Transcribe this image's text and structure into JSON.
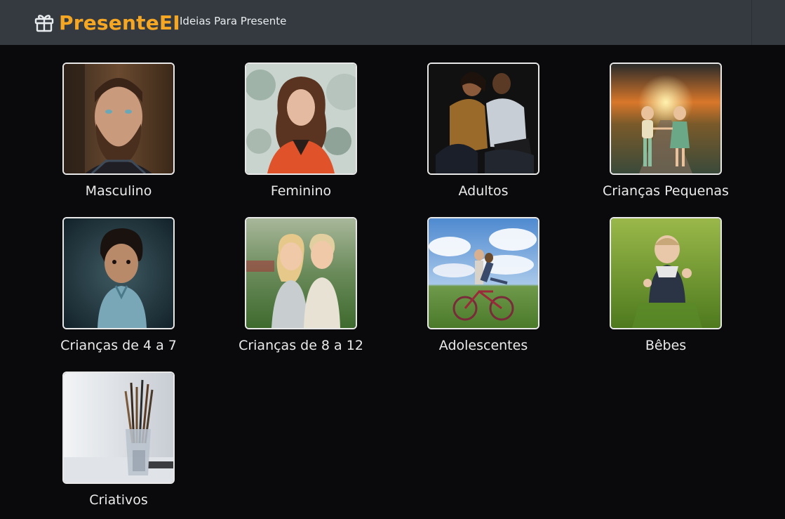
{
  "navbar": {
    "brand": "PresenteEI",
    "brand_icon": "gift-icon",
    "brand_color": "#f5a623",
    "links": [
      {
        "label": "Ideias Para Presente"
      }
    ]
  },
  "categories": [
    {
      "label": "Masculino",
      "image": "bearded-man-photo"
    },
    {
      "label": "Feminino",
      "image": "woman-in-snow-photo"
    },
    {
      "label": "Adultos",
      "image": "couple-with-laptop-photo"
    },
    {
      "label": "Crianças Pequenas",
      "image": "children-at-sunset-photo"
    },
    {
      "label": "Crianças de 4 a 7",
      "image": "curly-haired-boy-photo"
    },
    {
      "label": "Crianças de 8 a 12",
      "image": "two-kids-smiling-photo"
    },
    {
      "label": "Adolescentes",
      "image": "couple-on-bicycle-photo"
    },
    {
      "label": "Bêbes",
      "image": "baby-in-grass-photo"
    },
    {
      "label": "Criativos",
      "image": "paint-brushes-photo"
    }
  ]
}
